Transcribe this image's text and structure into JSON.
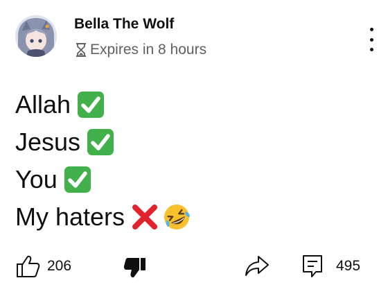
{
  "post": {
    "author": "Bella The Wolf",
    "expires": "Expires in 8 hours",
    "lines": [
      {
        "text": "Allah",
        "emojis": [
          "check-mark-button"
        ]
      },
      {
        "text": "Jesus",
        "emojis": [
          "check-mark-button"
        ]
      },
      {
        "text": "You",
        "emojis": [
          "check-mark-button"
        ]
      },
      {
        "text": "My haters",
        "emojis": [
          "cross-mark",
          "rolling-on-floor-laughing"
        ]
      }
    ]
  },
  "actions": {
    "like_count": "206",
    "comment_count": "495"
  },
  "icons": {
    "expires": "hourglass-icon",
    "like": "thumbs-up-icon",
    "dislike": "thumbs-down-icon",
    "share": "share-icon",
    "comment": "comment-icon",
    "menu": "more-vertical-icon"
  },
  "colors": {
    "check_green": "#43b14b",
    "cross_red": "#e0232e",
    "laugh_yellow": "#f7c02d",
    "text": "#0f0f0f",
    "secondary_text": "#606060"
  }
}
